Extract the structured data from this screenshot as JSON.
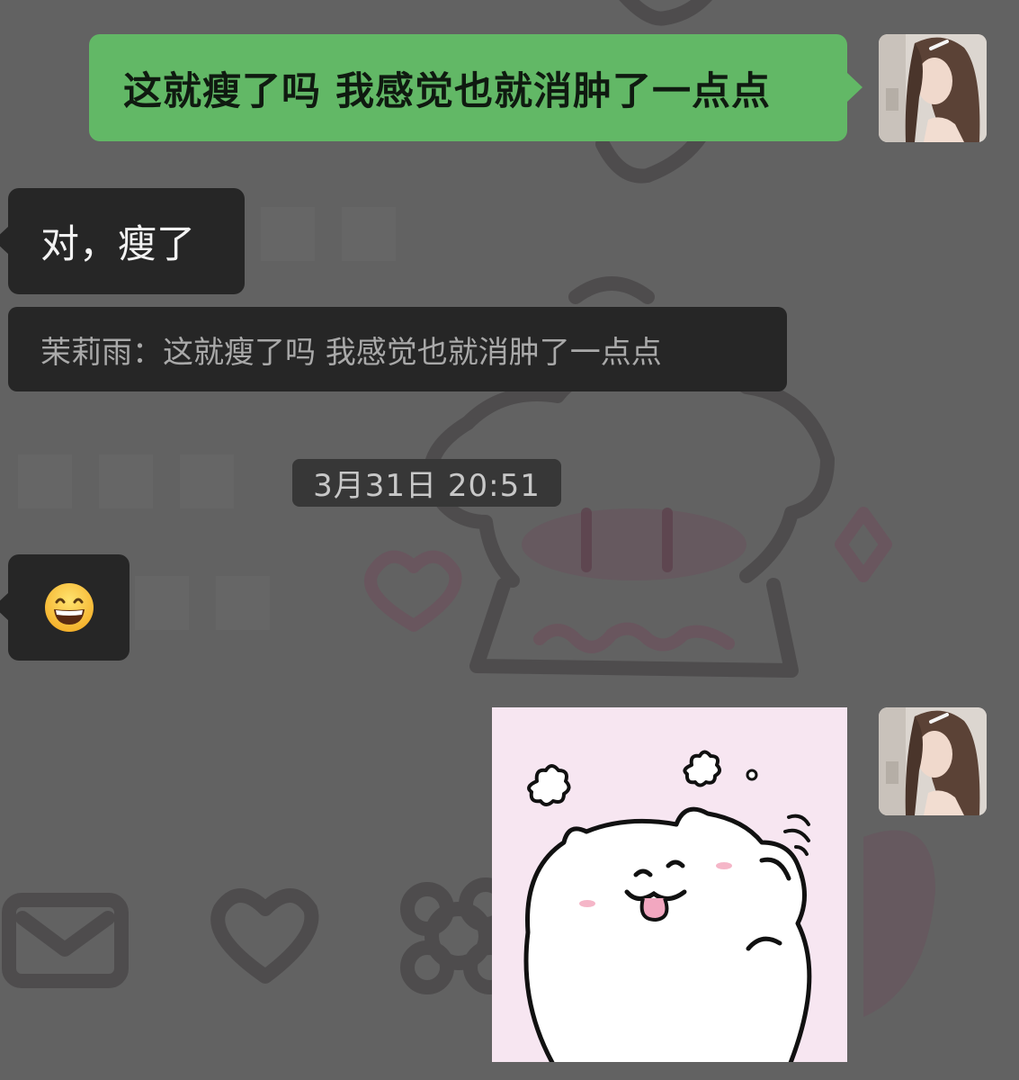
{
  "conversation": {
    "messages": [
      {
        "direction": "out",
        "type": "text",
        "text": "这就瘦了吗 我感觉也就消肿了一点点"
      },
      {
        "direction": "in",
        "type": "text",
        "text": "对，瘦了"
      },
      {
        "direction": "in",
        "type": "quote",
        "text": "茉莉雨：这就瘦了吗 我感觉也就消肿了一点点"
      },
      {
        "direction": "in",
        "type": "emoji",
        "icon": "grinning-face-icon"
      },
      {
        "direction": "out",
        "type": "sticker",
        "icon": "white-cat-sticker"
      }
    ],
    "timestamp": "3月31日 20:51"
  },
  "colors": {
    "outgoing_bubble": "#62b866",
    "incoming_bubble": "#262626",
    "background": "#626262"
  }
}
